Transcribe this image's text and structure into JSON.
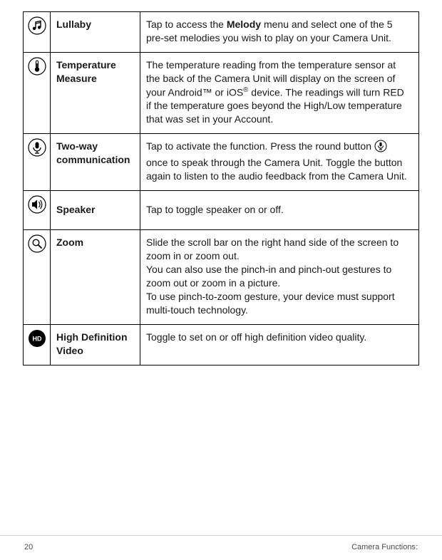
{
  "rows": [
    {
      "icon": "music-note-icon",
      "label": "Lullaby",
      "desc_pre": "Tap to access the ",
      "desc_bold": "Melody",
      "desc_post": " menu and select one of the 5 pre-set melodies you wish to play on your Camera Unit."
    },
    {
      "icon": "thermometer-icon",
      "label": "Temperature Measure",
      "desc": "The temperature reading from the temperature sensor at the back of the Camera Unit will display on the screen of your Android™ or iOS® device. The readings will turn RED if the temperature goes beyond the High/Low temperature that was set in your Account."
    },
    {
      "icon": "microphone-icon",
      "label": "Two-way communication",
      "desc_pre": "Tap to activate the function. Press the round button ",
      "desc_post": " once to speak through the Camera Unit. Toggle the button again to listen to the audio feedback from the Camera Unit.",
      "inline_icon": "microphone-button-icon"
    },
    {
      "icon": "speaker-icon",
      "label": "Speaker",
      "desc": "Tap to toggle speaker on or off."
    },
    {
      "icon": "magnifier-icon",
      "label": "Zoom",
      "desc": "Slide the scroll bar on the right hand side of the screen to zoom in or zoom out.\nYou can also use the pinch-in and pinch-out gestures to zoom out or zoom in a picture.\nTo use pinch-to-zoom gesture, your device must support multi-touch technology."
    },
    {
      "icon": "hd-icon",
      "label": "High Definition Video",
      "desc": "Toggle to set on or off high definition video quality."
    }
  ],
  "footer": {
    "page": "20",
    "section": "Camera Functions:"
  }
}
